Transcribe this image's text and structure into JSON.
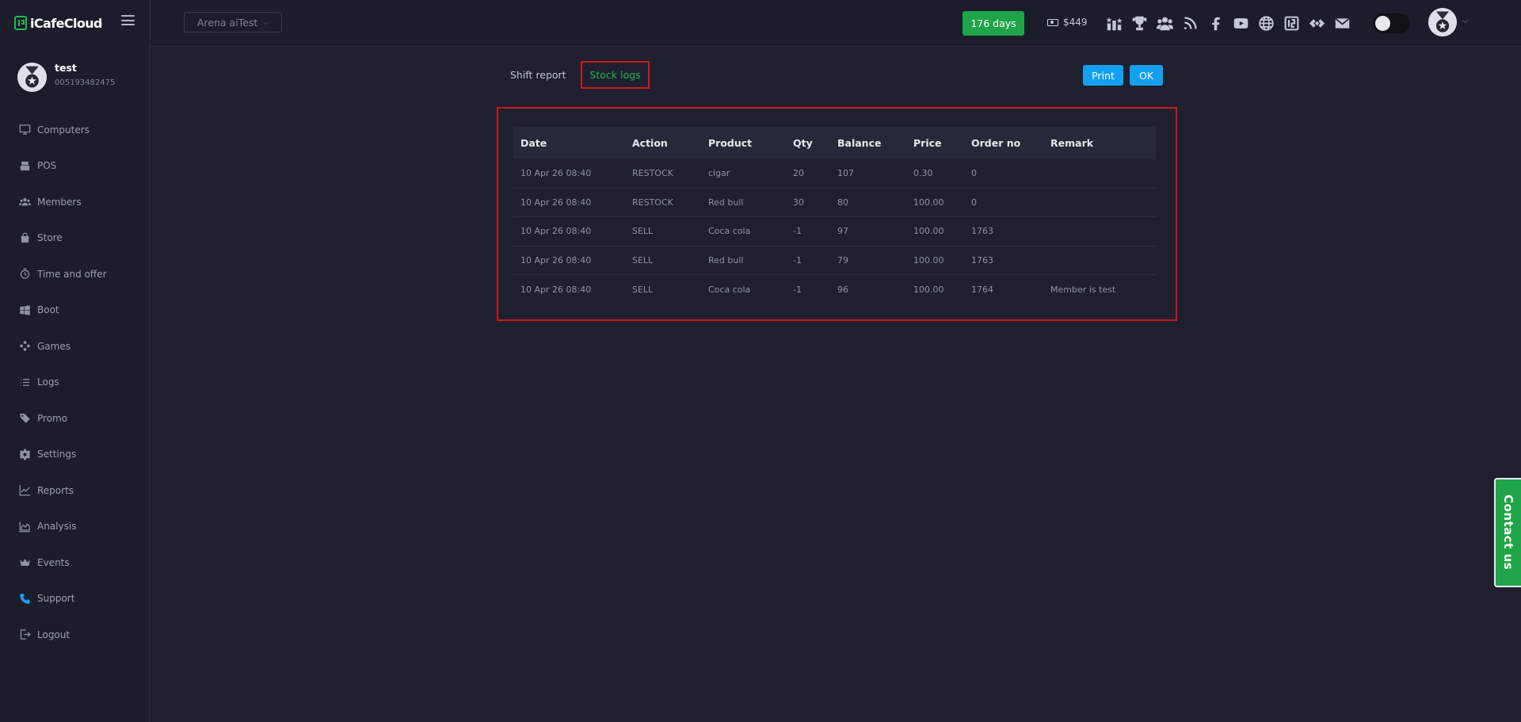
{
  "header": {
    "brand": "iCafeCloud",
    "arena": "Arena aiTest",
    "days": "176 days",
    "balance": "$449"
  },
  "header_icons": [
    "leaderboard-icon",
    "trophy-icon",
    "group-icon",
    "rss-icon",
    "facebook-icon",
    "youtube-icon",
    "globe-icon",
    "icafe-icon",
    "handshake-icon",
    "mail-icon"
  ],
  "user": {
    "name": "test",
    "id": "005193482475"
  },
  "sidebar": {
    "items": [
      {
        "label": "Computers",
        "icon": "monitor-icon"
      },
      {
        "label": "POS",
        "icon": "pos-icon"
      },
      {
        "label": "Members",
        "icon": "members-icon"
      },
      {
        "label": "Store",
        "icon": "store-icon"
      },
      {
        "label": "Time and offer",
        "icon": "timer-icon"
      },
      {
        "label": "Boot",
        "icon": "windows-icon"
      },
      {
        "label": "Games",
        "icon": "gamepad-icon"
      },
      {
        "label": "Logs",
        "icon": "list-icon"
      },
      {
        "label": "Promo",
        "icon": "tag-icon"
      },
      {
        "label": "Settings",
        "icon": "gear-icon"
      },
      {
        "label": "Reports",
        "icon": "line-chart-icon"
      },
      {
        "label": "Analysis",
        "icon": "area-chart-icon"
      },
      {
        "label": "Events",
        "icon": "crown-icon"
      },
      {
        "label": "Support",
        "icon": "phone-icon"
      },
      {
        "label": "Logout",
        "icon": "logout-icon"
      }
    ]
  },
  "tabs": {
    "shift_report": "Shift report",
    "stock_logs": "Stock logs"
  },
  "actions": {
    "print": "Print",
    "ok": "OK"
  },
  "table": {
    "headers": [
      "Date",
      "Action",
      "Product",
      "Qty",
      "Balance",
      "Price",
      "Order no",
      "Remark"
    ],
    "rows": [
      [
        "10 Apr 26 08:40",
        "RESTOCK",
        "cigar",
        "20",
        "107",
        "0.30",
        "0",
        ""
      ],
      [
        "10 Apr 26 08:40",
        "RESTOCK",
        "Red bull",
        "30",
        "80",
        "100.00",
        "0",
        ""
      ],
      [
        "10 Apr 26 08:40",
        "SELL",
        "Coca cola",
        "-1",
        "97",
        "100.00",
        "1763",
        ""
      ],
      [
        "10 Apr 26 08:40",
        "SELL",
        "Red bull",
        "-1",
        "79",
        "100.00",
        "1763",
        ""
      ],
      [
        "10 Apr 26 08:40",
        "SELL",
        "Coca cola",
        "-1",
        "96",
        "100.00",
        "1764",
        "Member is test"
      ]
    ]
  },
  "contact": "Contact us"
}
